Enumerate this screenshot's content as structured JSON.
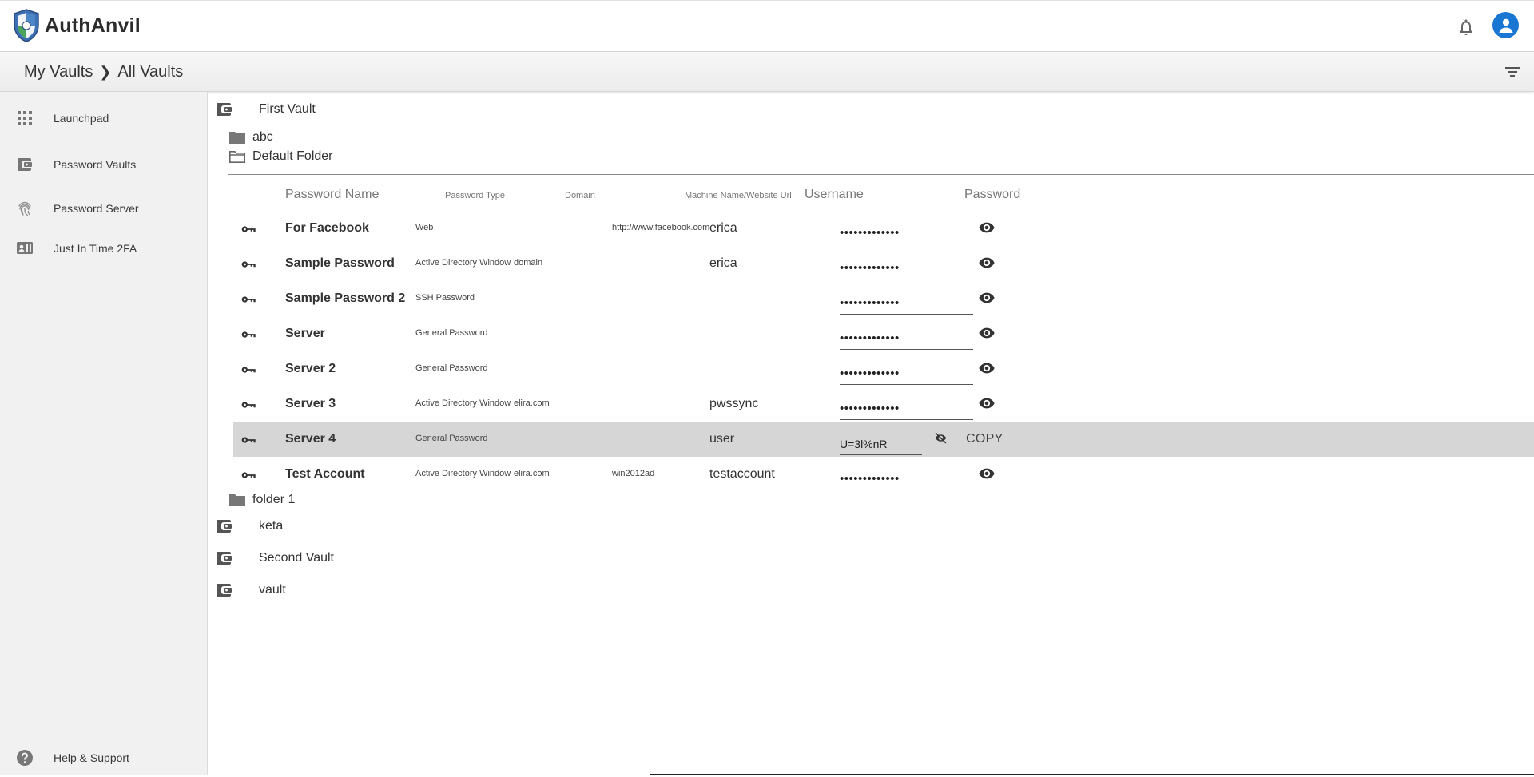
{
  "app": {
    "brand": "AuthAnvil"
  },
  "header": {
    "notifications_icon": "bell-icon",
    "account_icon": "account-circle-icon",
    "accent": "#1976d2"
  },
  "breadcrumb": {
    "root": "My Vaults",
    "current": "All Vaults"
  },
  "sidebar": {
    "items": [
      {
        "label": "Launchpad",
        "icon": "apps-grid-icon"
      },
      {
        "label": "Password Vaults",
        "icon": "wallet-icon"
      },
      {
        "label": "Password Server",
        "icon": "fingerprint-icon"
      },
      {
        "label": "Just In Time 2FA",
        "icon": "id-card-icon"
      }
    ],
    "help": {
      "label": "Help & Support",
      "icon": "help-circle-icon"
    }
  },
  "vaults": {
    "first": "First Vault",
    "folders": [
      "abc",
      "Default Folder",
      "folder 1"
    ],
    "others": [
      "keta",
      "Second Vault",
      "vault"
    ]
  },
  "table": {
    "headers": {
      "name": "Password Name",
      "type": "Password Type",
      "domain": "Domain",
      "url": "Machine Name/Website Url",
      "username": "Username",
      "password": "Password"
    },
    "rows": [
      {
        "name": "For Facebook",
        "type": "Web",
        "domain": "",
        "url": "http://www.facebook.com",
        "username": "erica",
        "password": "•••••••••••••"
      },
      {
        "name": "Sample Password",
        "type": "Active Directory Windows ...",
        "domain": "domain",
        "url": "",
        "username": "erica",
        "password": "•••••••••••••"
      },
      {
        "name": "Sample Password 2",
        "type": "SSH Password",
        "domain": "",
        "url": "",
        "username": "",
        "password": "•••••••••••••"
      },
      {
        "name": "Server",
        "type": "General Password",
        "domain": "",
        "url": "",
        "username": "",
        "password": "•••••••••••••"
      },
      {
        "name": "Server 2",
        "type": "General Password",
        "domain": "",
        "url": "",
        "username": "",
        "password": "•••••••••••••"
      },
      {
        "name": "Server 3",
        "type": "Active Directory Windows ...",
        "domain": "elira.com",
        "url": "",
        "username": "pwssync",
        "password": "•••••••••••••"
      },
      {
        "name": "Server 4",
        "type": "General Password",
        "domain": "",
        "url": "",
        "username": "user",
        "password": "U=3l%nR",
        "copy_label": "COPY"
      },
      {
        "name": "Test Account",
        "type": "Active Directory Windows ...",
        "domain": "elira.com",
        "url": "win2012ad",
        "username": "testaccount",
        "password": "•••••••••••••"
      }
    ]
  }
}
